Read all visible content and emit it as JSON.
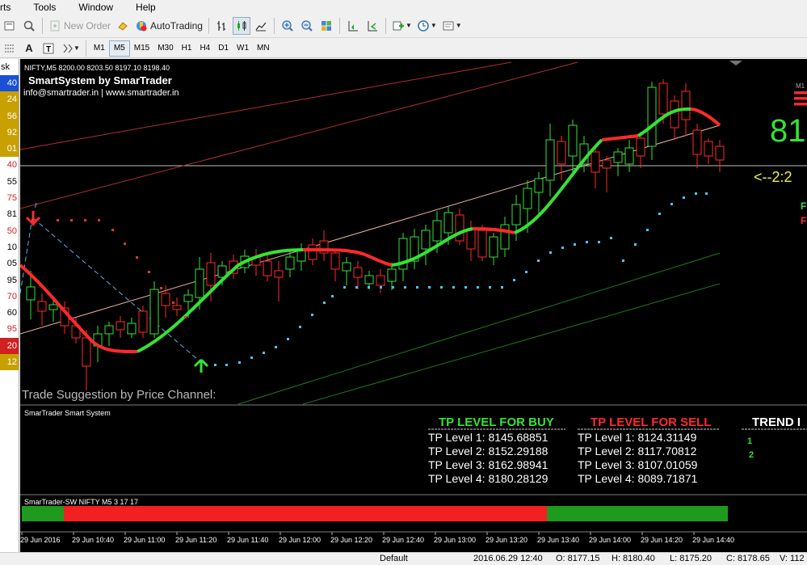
{
  "menu": [
    "rts",
    "Tools",
    "Window",
    "Help"
  ],
  "toolbar": {
    "new_order": "New Order",
    "autotrading": "AutoTrading"
  },
  "timeframes": [
    "M1",
    "M5",
    "M15",
    "M30",
    "H1",
    "H4",
    "D1",
    "W1",
    "MN"
  ],
  "active_timeframe": "M5",
  "left_panel": {
    "header": "sk",
    "rows": [
      {
        "t": "40",
        "c": "#1a4fd6",
        "hl": true
      },
      {
        "t": "24",
        "c": "#c8a000",
        "hl": true
      },
      {
        "t": "56",
        "c": "#c8a000",
        "hl": true
      },
      {
        "t": "92",
        "c": "#c8a000",
        "hl": true
      },
      {
        "t": "01",
        "c": "#c8a000",
        "hl": true
      },
      {
        "t": "40",
        "c": "#d02020",
        "hl": false
      },
      {
        "t": "55",
        "c": "#000000",
        "hl": false
      },
      {
        "t": "75",
        "c": "#d02020",
        "hl": false
      },
      {
        "t": "81",
        "c": "#000000",
        "hl": false
      },
      {
        "t": "50",
        "c": "#d02020",
        "hl": false
      },
      {
        "t": "10",
        "c": "#000000",
        "hl": false
      },
      {
        "t": "05",
        "c": "#000000",
        "hl": false
      },
      {
        "t": "95",
        "c": "#000000",
        "hl": false
      },
      {
        "t": "70",
        "c": "#d02020",
        "hl": false
      },
      {
        "t": "60",
        "c": "#000000",
        "hl": false
      },
      {
        "t": "95",
        "c": "#d02020",
        "hl": false
      },
      {
        "t": "20",
        "c": "#d02020",
        "hl": true
      },
      {
        "t": "12",
        "c": "#c8a000",
        "hl": true
      }
    ]
  },
  "chart": {
    "symbol_header": "NIFTY,M5  8200.00 8203.50 8197.10 8198.40",
    "brand": "SmartSystem by SmarTrader",
    "contact": "info@smartrader.in | www.smartrader.in",
    "right_label": "M1",
    "big_price": "81",
    "countdown": "<--2:2",
    "right_f": "F",
    "suggestion": "Trade Suggestion by Price Channel:",
    "colors": {
      "up": "#34e334",
      "down": "#ff2a2a",
      "buy_dots": "#45c8ff",
      "sell_dots": "#e03a2a",
      "grid": "#ffffff"
    }
  },
  "subwindow1": {
    "title": "SmarTrader Smart System",
    "buy_header": "TP LEVEL FOR BUY",
    "sell_header": "TP LEVEL FOR SELL",
    "trend_header": "TREND I",
    "buy_levels": [
      "TP Level 1: 8145.68851",
      "TP Level 2: 8152.29188",
      "TP Level 3: 8162.98941",
      "TP Level 4: 8180.28129"
    ],
    "sell_levels": [
      "TP Level 1: 8124.31149",
      "TP Level 2: 8117.70812",
      "TP Level 3: 8107.01059",
      "TP Level 4: 8089.71871"
    ],
    "trend_values": [
      "1",
      "2"
    ]
  },
  "subwindow2": {
    "title": "SmarTrader-SW NIFTY M5 3 17 17"
  },
  "xaxis": [
    "29 Jun 2016",
    "29 Jun 10:40",
    "29 Jun 11:00",
    "29 Jun 11:20",
    "29 Jun 11:40",
    "29 Jun 12:00",
    "29 Jun 12:20",
    "29 Jun 12:40",
    "29 Jun 13:00",
    "29 Jun 13:20",
    "29 Jun 13:40",
    "29 Jun 14:00",
    "29 Jun 14:20",
    "29 Jun 14:40"
  ],
  "status": {
    "profile": "Default",
    "datetime": "2016.06.29 12:40",
    "open": "O: 8177.15",
    "high": "H: 8180.40",
    "low": "L: 8175.20",
    "close": "C: 8178.65",
    "volume": "V: 112"
  }
}
